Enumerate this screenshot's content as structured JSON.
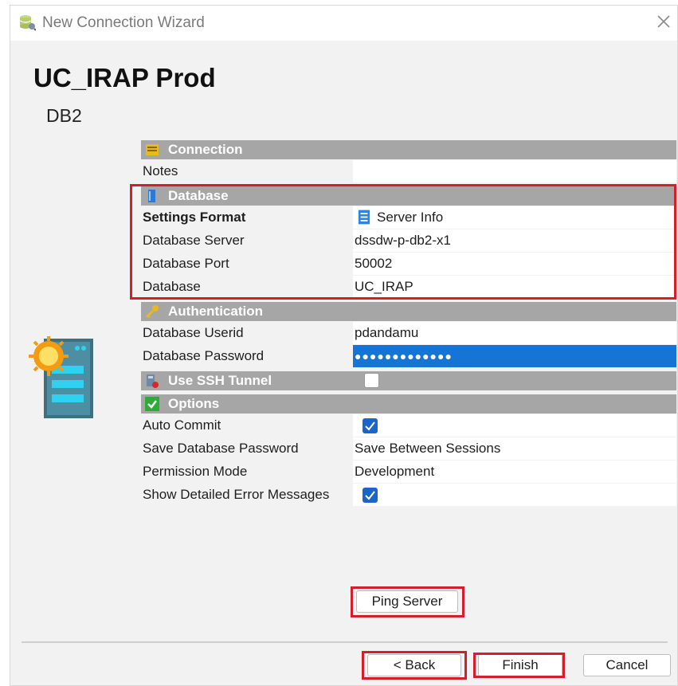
{
  "window": {
    "title": "New Connection Wizard"
  },
  "header": {
    "connection_name": "UC_IRAP Prod",
    "db_type": "DB2"
  },
  "sections": {
    "connection": "Connection",
    "database": "Database",
    "authentication": "Authentication",
    "ssh": "Use SSH Tunnel",
    "options": "Options"
  },
  "fields": {
    "notes": {
      "label": "Notes",
      "value": ""
    },
    "settings_format": {
      "label": "Settings Format",
      "value": "Server Info"
    },
    "db_server": {
      "label": "Database Server",
      "value": "dssdw-p-db2-x1"
    },
    "db_port": {
      "label": "Database Port",
      "value": "50002"
    },
    "database": {
      "label": "Database",
      "value": "UC_IRAP"
    },
    "userid": {
      "label": "Database Userid",
      "value": "pdandamu"
    },
    "password": {
      "label": "Database Password",
      "value": "●●●●●●●●●●●●●"
    },
    "ssh_checked": false,
    "auto_commit": {
      "label": "Auto Commit",
      "checked": true
    },
    "save_password": {
      "label": "Save Database Password",
      "value": "Save Between Sessions"
    },
    "permission_mode": {
      "label": "Permission Mode",
      "value": "Development"
    },
    "show_errors": {
      "label": "Show Detailed Error Messages",
      "checked": true
    }
  },
  "buttons": {
    "ping": "Ping Server",
    "back": "< Back",
    "finish": "Finish",
    "cancel": "Cancel"
  },
  "colors": {
    "highlight": "#d41e2a",
    "section_bar": "#a6a6a6",
    "selection": "#1574d4",
    "checkbox": "#1a66c8"
  }
}
